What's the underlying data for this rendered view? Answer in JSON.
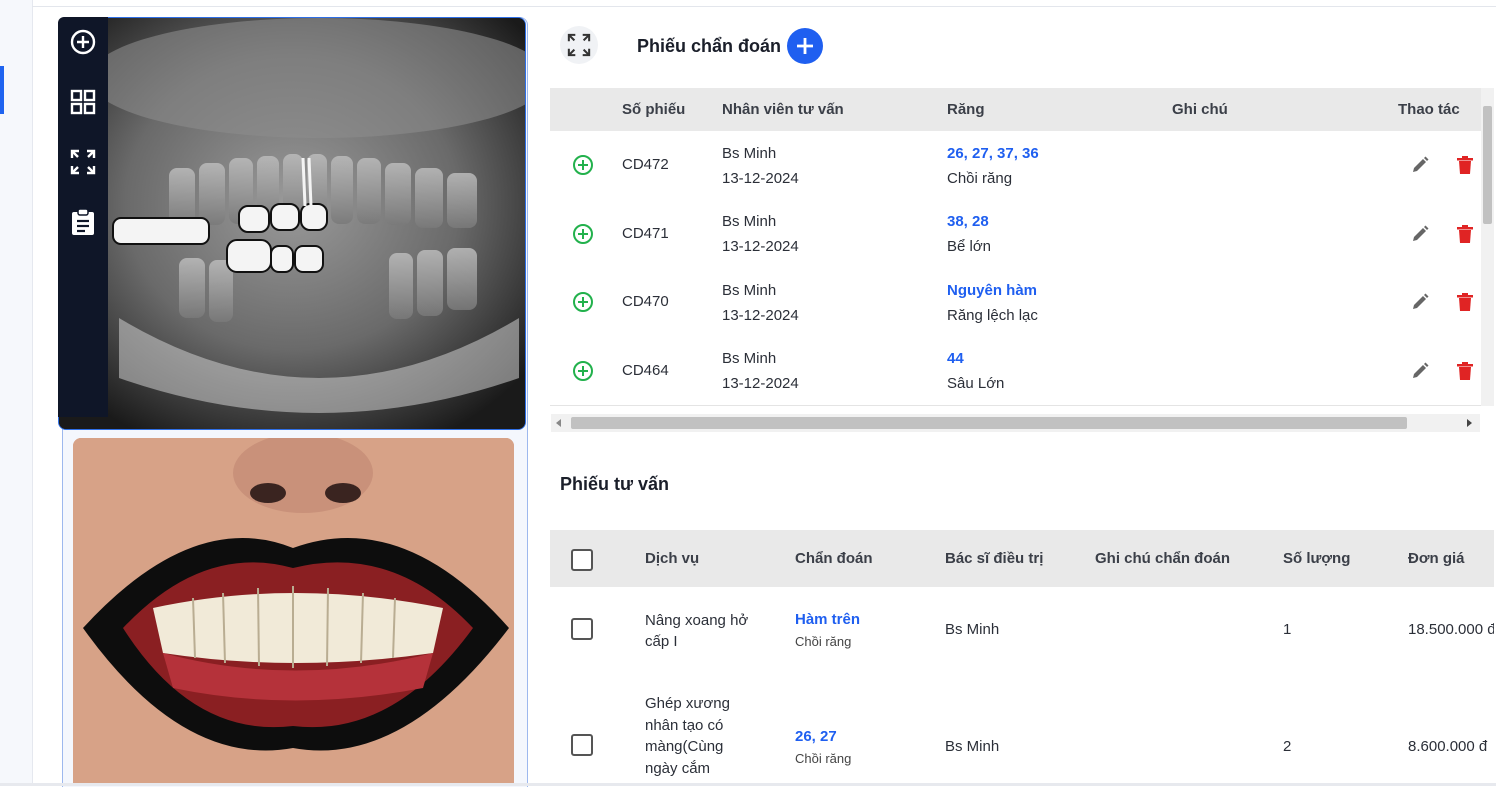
{
  "diagnosis": {
    "title": "Phiếu chẩn đoán",
    "columns": [
      "Số phiếu",
      "Nhân viên tư vấn",
      "Răng",
      "Ghi chú",
      "Thao tác"
    ],
    "rows": [
      {
        "code": "CD472",
        "staff": "Bs Minh",
        "date": "13-12-2024",
        "teeth": "26, 27, 37, 36",
        "note": "Chồi răng"
      },
      {
        "code": "CD471",
        "staff": "Bs Minh",
        "date": "13-12-2024",
        "teeth": "38, 28",
        "note": "Bể lớn"
      },
      {
        "code": "CD470",
        "staff": "Bs Minh",
        "date": "13-12-2024",
        "teeth": "Nguyên hàm",
        "note": "Răng lệch lạc"
      },
      {
        "code": "CD464",
        "staff": "Bs Minh",
        "date": "13-12-2024",
        "teeth": "44",
        "note": "Sâu Lớn"
      }
    ]
  },
  "consult": {
    "title": "Phiếu tư vấn",
    "columns": [
      "Dịch vụ",
      "Chẩn đoán",
      "Bác sĩ điều trị",
      "Ghi chú chẩn đoán",
      "Số lượng",
      "Đơn giá"
    ],
    "rows": [
      {
        "service_l1": "Nâng xoang hở",
        "service_l2": "cấp I",
        "diag": "Hàm trên",
        "diag_note": "Chồi răng",
        "doctor": "Bs Minh",
        "qty": "1",
        "price": "18.500.000 đ"
      },
      {
        "service_l1": "Ghép xương",
        "service_l2": "nhân tạo có",
        "service_l3": "màng(Cùng",
        "service_l4": "ngày cắm",
        "diag": "26, 27",
        "diag_note": "Chồi răng",
        "doctor": "Bs Minh",
        "qty": "2",
        "price": "8.600.000 đ"
      }
    ]
  },
  "icons": {
    "rail": [
      "plus-circle-icon",
      "grid-icon",
      "expand-icon",
      "clipboard-icon"
    ],
    "row_add": "plus-circle-icon",
    "edit": "pencil-icon",
    "delete": "trash-icon"
  },
  "colors": {
    "accent": "#1f5ff0",
    "green": "#22b14c",
    "red": "#e02424",
    "rail": "#0f1628"
  }
}
